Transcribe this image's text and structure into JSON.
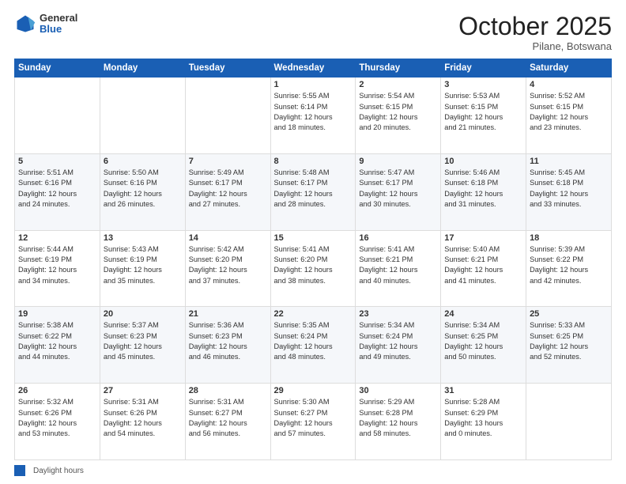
{
  "logo": {
    "general": "General",
    "blue": "Blue"
  },
  "header": {
    "month": "October 2025",
    "location": "Pilane, Botswana"
  },
  "days_of_week": [
    "Sunday",
    "Monday",
    "Tuesday",
    "Wednesday",
    "Thursday",
    "Friday",
    "Saturday"
  ],
  "footer": {
    "legend_label": "Daylight hours"
  },
  "weeks": [
    [
      {
        "day": "",
        "info": ""
      },
      {
        "day": "",
        "info": ""
      },
      {
        "day": "",
        "info": ""
      },
      {
        "day": "1",
        "info": "Sunrise: 5:55 AM\nSunset: 6:14 PM\nDaylight: 12 hours\nand 18 minutes."
      },
      {
        "day": "2",
        "info": "Sunrise: 5:54 AM\nSunset: 6:15 PM\nDaylight: 12 hours\nand 20 minutes."
      },
      {
        "day": "3",
        "info": "Sunrise: 5:53 AM\nSunset: 6:15 PM\nDaylight: 12 hours\nand 21 minutes."
      },
      {
        "day": "4",
        "info": "Sunrise: 5:52 AM\nSunset: 6:15 PM\nDaylight: 12 hours\nand 23 minutes."
      }
    ],
    [
      {
        "day": "5",
        "info": "Sunrise: 5:51 AM\nSunset: 6:16 PM\nDaylight: 12 hours\nand 24 minutes."
      },
      {
        "day": "6",
        "info": "Sunrise: 5:50 AM\nSunset: 6:16 PM\nDaylight: 12 hours\nand 26 minutes."
      },
      {
        "day": "7",
        "info": "Sunrise: 5:49 AM\nSunset: 6:17 PM\nDaylight: 12 hours\nand 27 minutes."
      },
      {
        "day": "8",
        "info": "Sunrise: 5:48 AM\nSunset: 6:17 PM\nDaylight: 12 hours\nand 28 minutes."
      },
      {
        "day": "9",
        "info": "Sunrise: 5:47 AM\nSunset: 6:17 PM\nDaylight: 12 hours\nand 30 minutes."
      },
      {
        "day": "10",
        "info": "Sunrise: 5:46 AM\nSunset: 6:18 PM\nDaylight: 12 hours\nand 31 minutes."
      },
      {
        "day": "11",
        "info": "Sunrise: 5:45 AM\nSunset: 6:18 PM\nDaylight: 12 hours\nand 33 minutes."
      }
    ],
    [
      {
        "day": "12",
        "info": "Sunrise: 5:44 AM\nSunset: 6:19 PM\nDaylight: 12 hours\nand 34 minutes."
      },
      {
        "day": "13",
        "info": "Sunrise: 5:43 AM\nSunset: 6:19 PM\nDaylight: 12 hours\nand 35 minutes."
      },
      {
        "day": "14",
        "info": "Sunrise: 5:42 AM\nSunset: 6:20 PM\nDaylight: 12 hours\nand 37 minutes."
      },
      {
        "day": "15",
        "info": "Sunrise: 5:41 AM\nSunset: 6:20 PM\nDaylight: 12 hours\nand 38 minutes."
      },
      {
        "day": "16",
        "info": "Sunrise: 5:41 AM\nSunset: 6:21 PM\nDaylight: 12 hours\nand 40 minutes."
      },
      {
        "day": "17",
        "info": "Sunrise: 5:40 AM\nSunset: 6:21 PM\nDaylight: 12 hours\nand 41 minutes."
      },
      {
        "day": "18",
        "info": "Sunrise: 5:39 AM\nSunset: 6:22 PM\nDaylight: 12 hours\nand 42 minutes."
      }
    ],
    [
      {
        "day": "19",
        "info": "Sunrise: 5:38 AM\nSunset: 6:22 PM\nDaylight: 12 hours\nand 44 minutes."
      },
      {
        "day": "20",
        "info": "Sunrise: 5:37 AM\nSunset: 6:23 PM\nDaylight: 12 hours\nand 45 minutes."
      },
      {
        "day": "21",
        "info": "Sunrise: 5:36 AM\nSunset: 6:23 PM\nDaylight: 12 hours\nand 46 minutes."
      },
      {
        "day": "22",
        "info": "Sunrise: 5:35 AM\nSunset: 6:24 PM\nDaylight: 12 hours\nand 48 minutes."
      },
      {
        "day": "23",
        "info": "Sunrise: 5:34 AM\nSunset: 6:24 PM\nDaylight: 12 hours\nand 49 minutes."
      },
      {
        "day": "24",
        "info": "Sunrise: 5:34 AM\nSunset: 6:25 PM\nDaylight: 12 hours\nand 50 minutes."
      },
      {
        "day": "25",
        "info": "Sunrise: 5:33 AM\nSunset: 6:25 PM\nDaylight: 12 hours\nand 52 minutes."
      }
    ],
    [
      {
        "day": "26",
        "info": "Sunrise: 5:32 AM\nSunset: 6:26 PM\nDaylight: 12 hours\nand 53 minutes."
      },
      {
        "day": "27",
        "info": "Sunrise: 5:31 AM\nSunset: 6:26 PM\nDaylight: 12 hours\nand 54 minutes."
      },
      {
        "day": "28",
        "info": "Sunrise: 5:31 AM\nSunset: 6:27 PM\nDaylight: 12 hours\nand 56 minutes."
      },
      {
        "day": "29",
        "info": "Sunrise: 5:30 AM\nSunset: 6:27 PM\nDaylight: 12 hours\nand 57 minutes."
      },
      {
        "day": "30",
        "info": "Sunrise: 5:29 AM\nSunset: 6:28 PM\nDaylight: 12 hours\nand 58 minutes."
      },
      {
        "day": "31",
        "info": "Sunrise: 5:28 AM\nSunset: 6:29 PM\nDaylight: 13 hours\nand 0 minutes."
      },
      {
        "day": "",
        "info": ""
      }
    ]
  ]
}
